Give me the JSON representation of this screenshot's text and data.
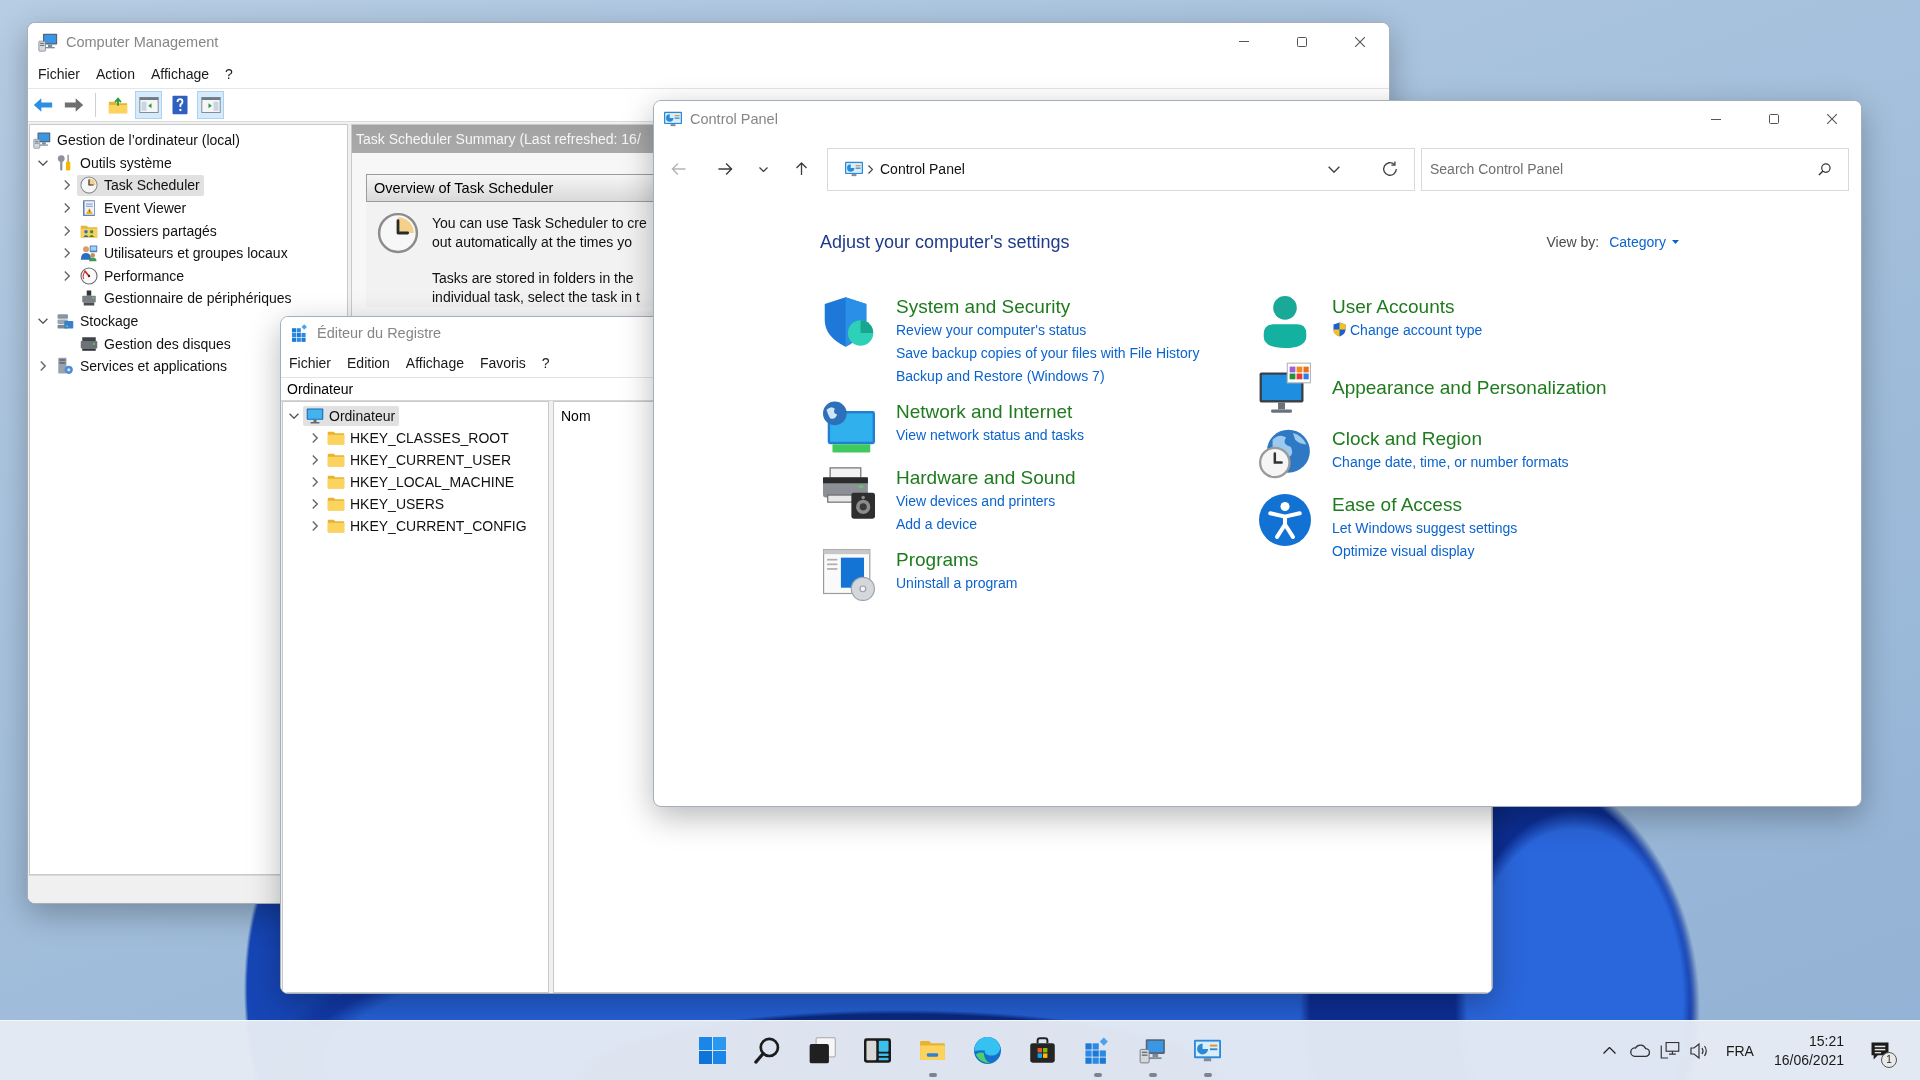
{
  "computer_management": {
    "title": "Computer Management",
    "menu": [
      "Fichier",
      "Action",
      "Affichage",
      "?"
    ],
    "toolbar_groups": [
      [
        {
          "kind": "back",
          "pressed": false
        },
        {
          "kind": "forward",
          "pressed": false
        }
      ],
      [
        {
          "kind": "up-folder",
          "pressed": false
        },
        {
          "kind": "console-tree",
          "pressed": true
        },
        {
          "kind": "help",
          "pressed": false
        },
        {
          "kind": "action-pane",
          "pressed": true
        }
      ]
    ],
    "tree": [
      {
        "kind": "computer-management",
        "label": "Gestion de l’ordinateur (local)",
        "selected": false,
        "children": [
          {
            "kind": "tools",
            "label": "Outils système",
            "expanded": true,
            "selected": false,
            "children": [
              {
                "kind": "clock",
                "label": "Task Scheduler",
                "expanded": false,
                "selected": true
              },
              {
                "kind": "event-log",
                "label": "Event Viewer",
                "expanded": false,
                "selected": false
              },
              {
                "kind": "shared-folders",
                "label": "Dossiers partagés",
                "expanded": false,
                "selected": false
              },
              {
                "kind": "users",
                "label": "Utilisateurs et groupes locaux",
                "expanded": false,
                "selected": false
              },
              {
                "kind": "performance",
                "label": "Performance",
                "expanded": false,
                "selected": false
              },
              {
                "kind": "device-manager",
                "label": "Gestionnaire de périphériques",
                "selected": false
              }
            ]
          },
          {
            "kind": "storage",
            "label": "Stockage",
            "expanded": true,
            "selected": false,
            "children": [
              {
                "kind": "disk-drive",
                "label": "Gestion des disques",
                "selected": false
              }
            ]
          },
          {
            "kind": "services",
            "label": "Services et applications",
            "expanded": false,
            "selected": false
          }
        ]
      }
    ],
    "summary": {
      "header": "Task Scheduler Summary (Last refreshed: 16/",
      "section_title": "Overview of Task Scheduler",
      "paragraphs": [
        [
          "You can use Task Scheduler to cre",
          "out automatically at the times yo"
        ],
        [
          "Tasks are stored in folders in the",
          "individual task, select the task in t"
        ]
      ]
    }
  },
  "registry_editor": {
    "title": "Éditeur du Registre",
    "menu": [
      "Fichier",
      "Edition",
      "Affichage",
      "Favoris",
      "?"
    ],
    "address": "Ordinateur",
    "tree": [
      {
        "kind": "computer",
        "label": "Ordinateur",
        "expanded": true,
        "selected": true,
        "children": [
          {
            "kind": "folder",
            "label": "HKEY_CLASSES_ROOT",
            "expanded": false,
            "selected": false
          },
          {
            "kind": "folder",
            "label": "HKEY_CURRENT_USER",
            "expanded": false,
            "selected": false
          },
          {
            "kind": "folder",
            "label": "HKEY_LOCAL_MACHINE",
            "expanded": false,
            "selected": false
          },
          {
            "kind": "folder",
            "label": "HKEY_USERS",
            "expanded": false,
            "selected": false
          },
          {
            "kind": "folder",
            "label": "HKEY_CURRENT_CONFIG",
            "expanded": false,
            "selected": false
          }
        ]
      }
    ],
    "columns": [
      "Nom"
    ]
  },
  "control_panel": {
    "title": "Control Panel",
    "nav": [
      {
        "kind": "back",
        "disabled": true
      },
      {
        "kind": "forward",
        "disabled": false
      },
      {
        "kind": "recent",
        "disabled": false
      },
      {
        "kind": "up",
        "disabled": false
      }
    ],
    "address": {
      "crumbs": [
        "Control Panel"
      ]
    },
    "search": {
      "placeholder": "Search Control Panel"
    },
    "heading": "Adjust your computer's settings",
    "view_by": {
      "label": "View by:",
      "value": "Category"
    },
    "columns": [
      {
        "categories": [
          {
            "kind": "system-security",
            "title": "System and Security",
            "links": [
              {
                "label": "Review your computer's status",
                "shield": false
              },
              {
                "label": "Save backup copies of your files with File History",
                "shield": false
              },
              {
                "label": "Backup and Restore (Windows 7)",
                "shield": false
              }
            ]
          },
          {
            "kind": "network-internet",
            "title": "Network and Internet",
            "links": [
              {
                "label": "View network status and tasks",
                "shield": false
              }
            ]
          },
          {
            "kind": "hardware-sound",
            "title": "Hardware and Sound",
            "links": [
              {
                "label": "View devices and printers",
                "shield": false
              },
              {
                "label": "Add a device",
                "shield": false
              }
            ]
          },
          {
            "kind": "programs",
            "title": "Programs",
            "links": [
              {
                "label": "Uninstall a program",
                "shield": false
              }
            ]
          }
        ]
      },
      {
        "categories": [
          {
            "kind": "user-accounts",
            "title": "User Accounts",
            "links": [
              {
                "label": "Change account type",
                "shield": true
              }
            ]
          },
          {
            "kind": "appearance",
            "title": "Appearance and Personalization"
          },
          {
            "kind": "clock-region",
            "title": "Clock and Region",
            "links": [
              {
                "label": "Change date, time, or number formats",
                "shield": false
              }
            ]
          },
          {
            "kind": "ease-of-access",
            "title": "Ease of Access",
            "links": [
              {
                "label": "Let Windows suggest settings",
                "shield": false
              },
              {
                "label": "Optimize visual display",
                "shield": false
              }
            ]
          }
        ]
      }
    ]
  },
  "taskbar": {
    "apps": [
      {
        "kind": "start",
        "running": false
      },
      {
        "kind": "search",
        "running": false
      },
      {
        "kind": "task-view",
        "running": false
      },
      {
        "kind": "widgets",
        "running": false
      },
      {
        "kind": "file-explorer",
        "running": true
      },
      {
        "kind": "browser",
        "running": false
      },
      {
        "kind": "store",
        "running": false
      },
      {
        "kind": "registry-editor",
        "running": true
      },
      {
        "kind": "computer-management",
        "running": true
      },
      {
        "kind": "control-panel",
        "running": true
      }
    ],
    "tray": {
      "language": "FRA",
      "time": "15:21",
      "date": "16/06/2021",
      "notification_count": "1"
    }
  }
}
